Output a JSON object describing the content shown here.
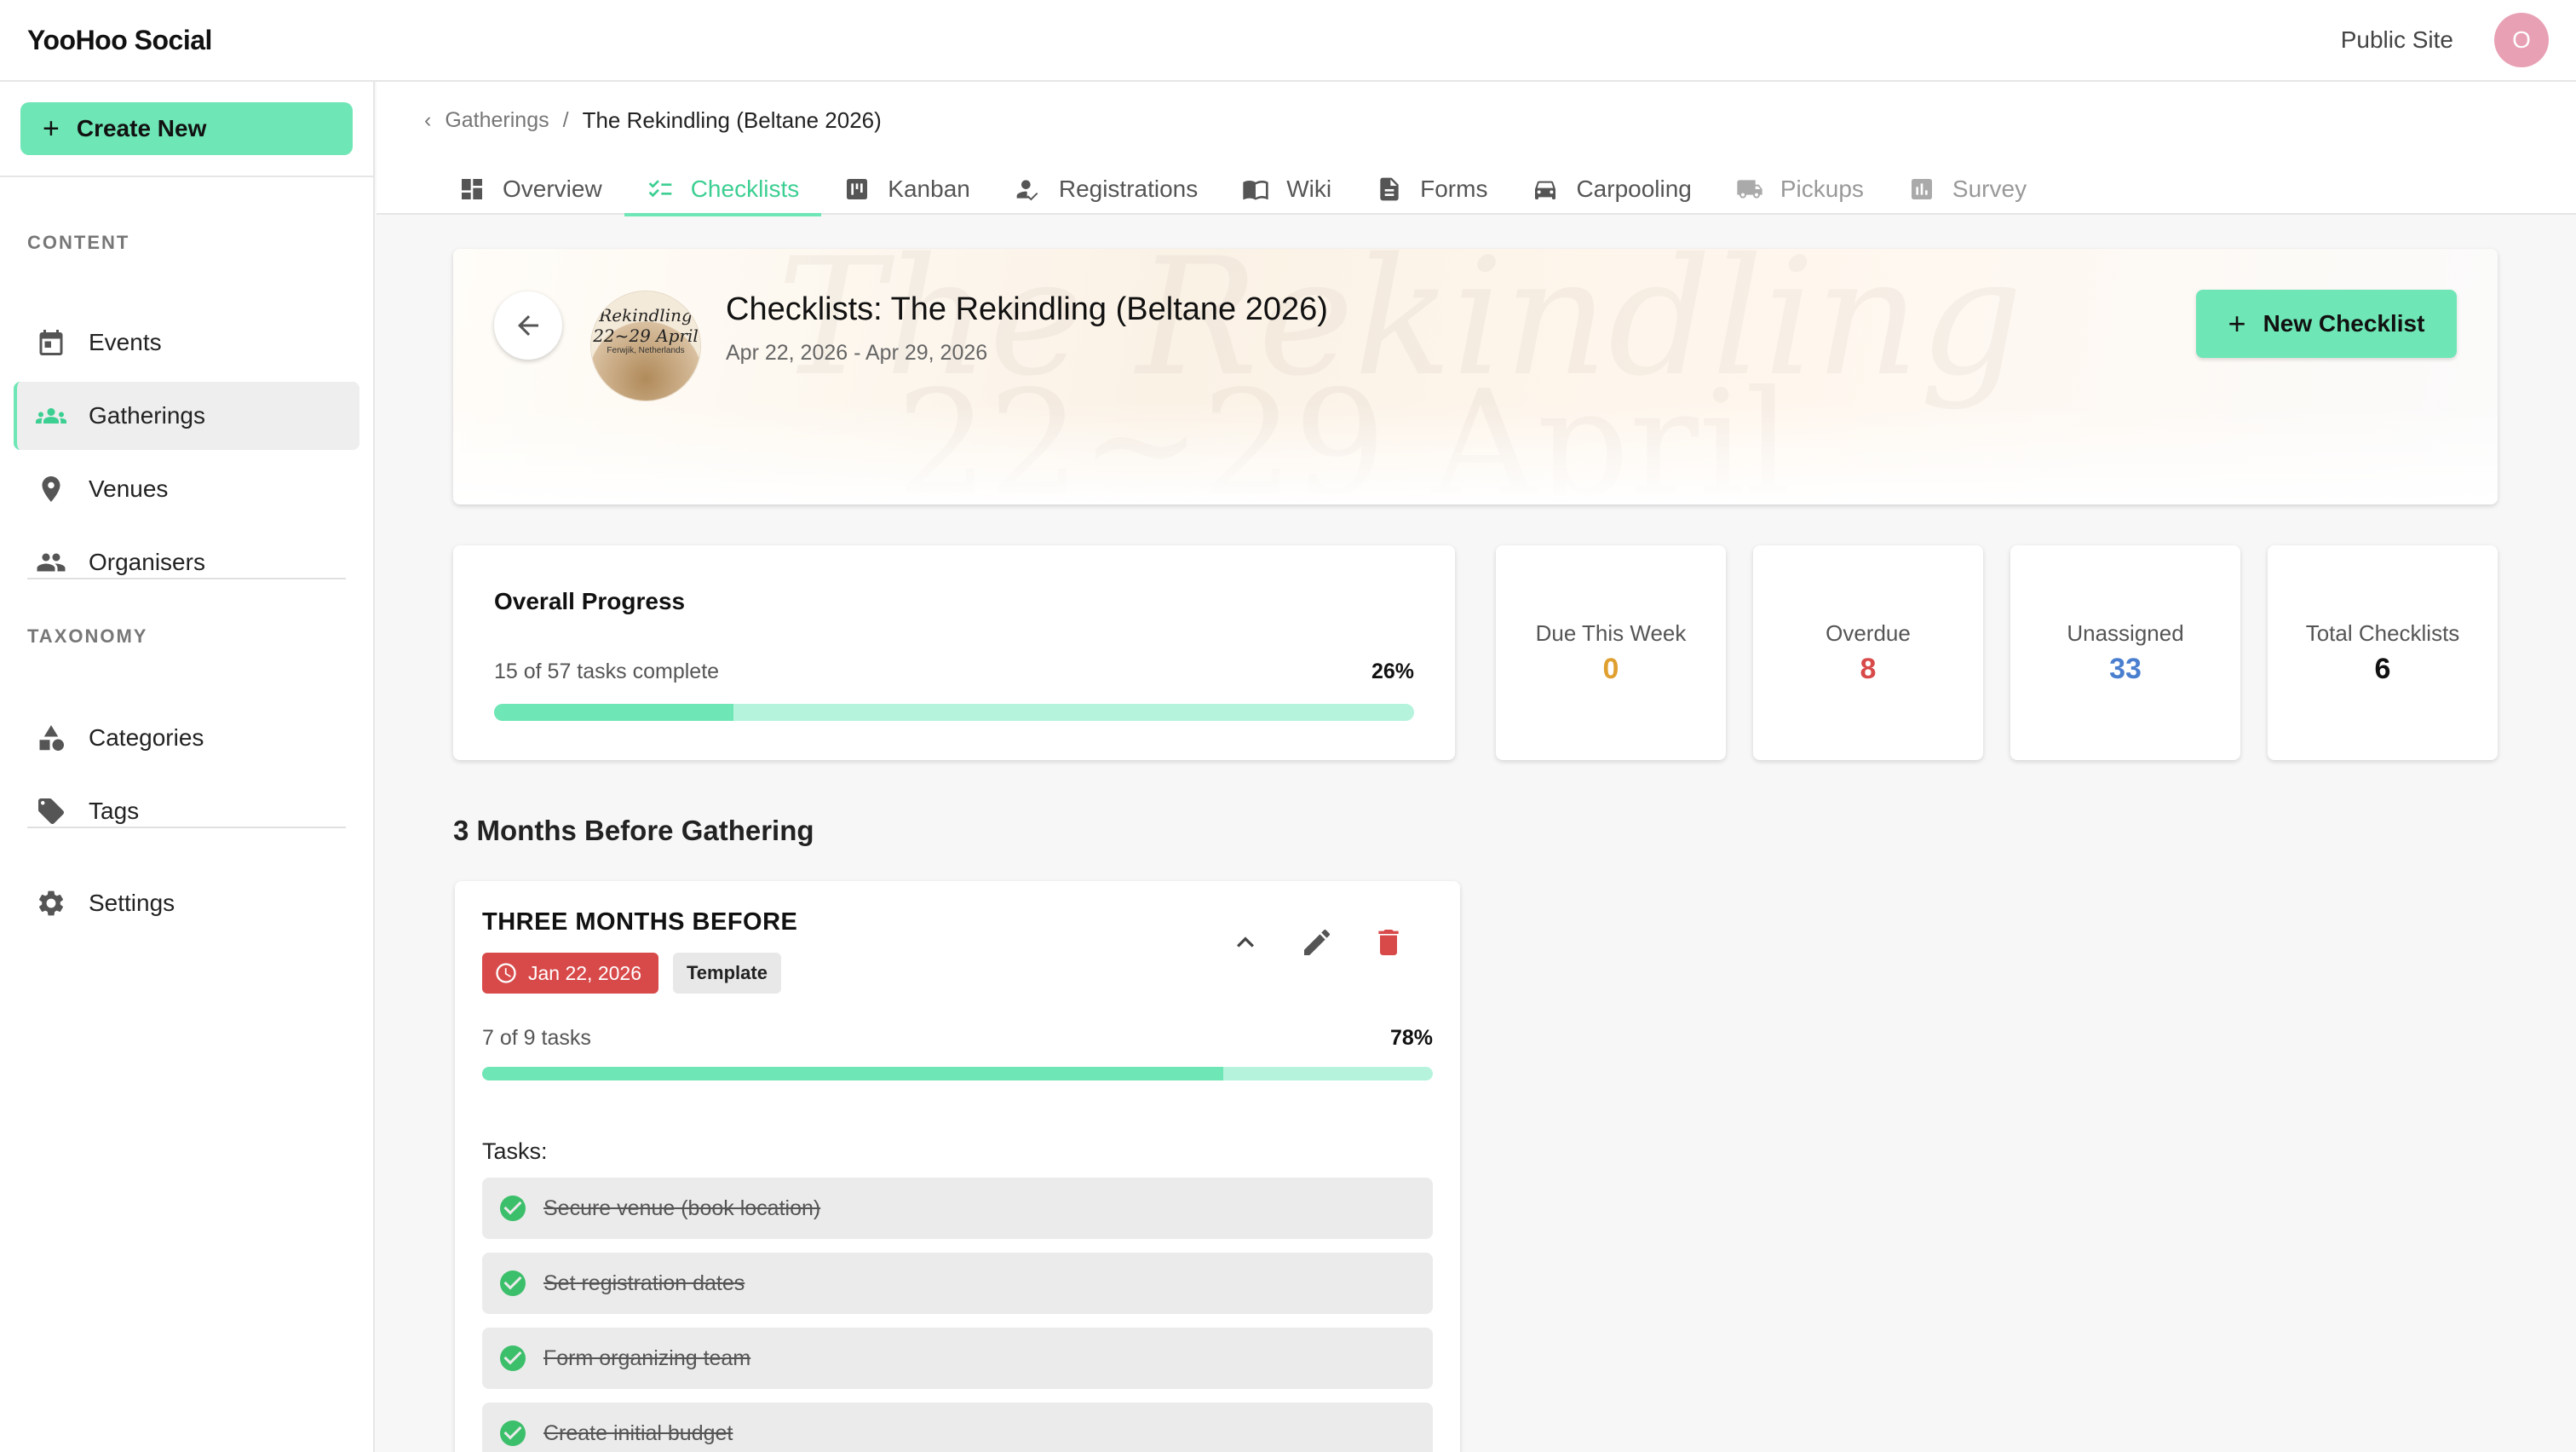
{
  "app": {
    "brand": "YooHoo Social",
    "public_site": "Public Site",
    "avatar_initial": "O"
  },
  "sidebar": {
    "create_new": "Create New",
    "sections": {
      "content": "CONTENT",
      "taxonomy": "TAXONOMY"
    },
    "items": [
      {
        "label": "Events",
        "icon": "calendar-icon"
      },
      {
        "label": "Gatherings",
        "icon": "groups-icon",
        "active": true
      },
      {
        "label": "Venues",
        "icon": "location-pin-icon"
      },
      {
        "label": "Organisers",
        "icon": "people-icon"
      },
      {
        "label": "Categories",
        "icon": "shapes-icon"
      },
      {
        "label": "Tags",
        "icon": "tag-icon"
      },
      {
        "label": "Settings",
        "icon": "gear-icon"
      }
    ]
  },
  "breadcrumb": {
    "parent": "Gatherings",
    "separator": "/",
    "current": "The Rekindling (Beltane 2026)"
  },
  "tabs": [
    {
      "label": "Overview",
      "icon": "dashboard-icon"
    },
    {
      "label": "Checklists",
      "icon": "checklist-icon",
      "active": true
    },
    {
      "label": "Kanban",
      "icon": "kanban-icon"
    },
    {
      "label": "Registrations",
      "icon": "person-check-icon"
    },
    {
      "label": "Wiki",
      "icon": "book-icon"
    },
    {
      "label": "Forms",
      "icon": "document-icon"
    },
    {
      "label": "Carpooling",
      "icon": "car-icon"
    },
    {
      "label": "Pickups",
      "icon": "truck-icon",
      "disabled": true
    },
    {
      "label": "Survey",
      "icon": "bar-chart-icon",
      "disabled": true
    }
  ],
  "hero": {
    "title": "Checklists: The Rekindling (Beltane 2026)",
    "dates": "Apr 22, 2026 - Apr 29, 2026",
    "new_checklist": "New Checklist",
    "logo": {
      "line1": "Rekindling",
      "line2": "22~29 April",
      "line3": "Ferwjik, Netherlands"
    }
  },
  "overall_progress": {
    "title": "Overall Progress",
    "summary": "15 of 57 tasks complete",
    "percent_label": "26%",
    "fraction": 0.26
  },
  "stats": [
    {
      "label": "Due This Week",
      "value": "0",
      "color": "#e0a030"
    },
    {
      "label": "Overdue",
      "value": "8",
      "color": "#d84a4a"
    },
    {
      "label": "Unassigned",
      "value": "33",
      "color": "#4a7fd0"
    },
    {
      "label": "Total Checklists",
      "value": "6",
      "color": "#111111"
    }
  ],
  "section_title": "3 Months Before Gathering",
  "checklist": {
    "title": "THREE MONTHS BEFORE",
    "due_date": "Jan 22, 2026",
    "template_badge": "Template",
    "summary": "7 of 9 tasks",
    "percent_label": "78%",
    "fraction": 0.78,
    "tasks_label": "Tasks:",
    "tasks": [
      "Secure venue (book location)",
      "Set registration dates",
      "Form organizing team",
      "Create initial budget"
    ]
  },
  "colors": {
    "accent": "#6ee6b5",
    "accent_dark": "#3ccf92",
    "danger": "#d84a4a"
  }
}
